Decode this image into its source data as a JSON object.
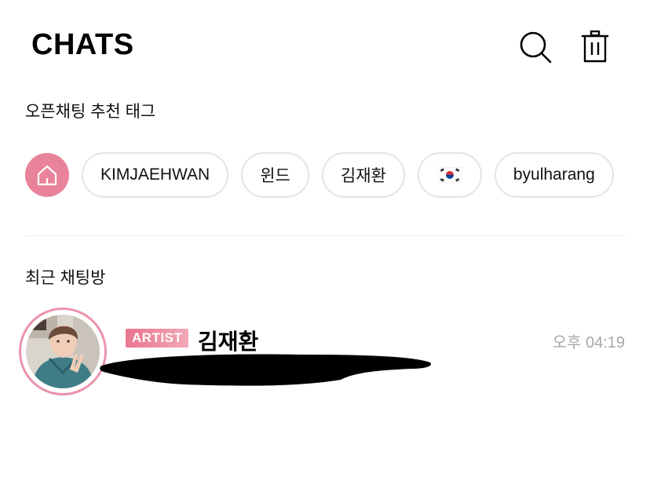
{
  "header": {
    "title": "CHATS"
  },
  "icons": {
    "search": "search-icon",
    "trash": "trash-icon",
    "home": "home-icon",
    "flag": "korea-flag-icon"
  },
  "tags_section": {
    "label": "오픈채팅 추천 태그",
    "tags": [
      {
        "label": "KIMJAEHWAN"
      },
      {
        "label": "윈드"
      },
      {
        "label": "김재환"
      },
      {
        "label": "🇰🇷"
      },
      {
        "label": "byulharang"
      }
    ]
  },
  "recent_section": {
    "label": "최근 채팅방"
  },
  "chats": [
    {
      "badge": "ARTIST",
      "name": "김재환",
      "time": "오후 04:19"
    }
  ],
  "colors": {
    "accent": "#e8839b",
    "badge_start": "#e9768f",
    "badge_end": "#f2a8b8",
    "time": "#a8a8a8"
  }
}
